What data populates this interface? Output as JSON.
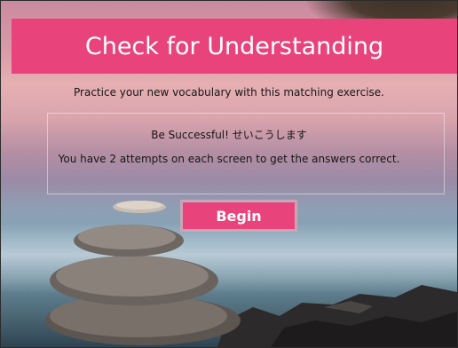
{
  "header": {
    "title": "Check for Understanding"
  },
  "content": {
    "intro": "Practice your new vocabulary with this matching exercise.",
    "line1": "Be Successful! せいこうします",
    "line2": "You have 2 attempts on each screen to get the answers correct."
  },
  "actions": {
    "begin_label": "Begin"
  },
  "colors": {
    "accent": "#e8437a",
    "text": "#161616"
  }
}
